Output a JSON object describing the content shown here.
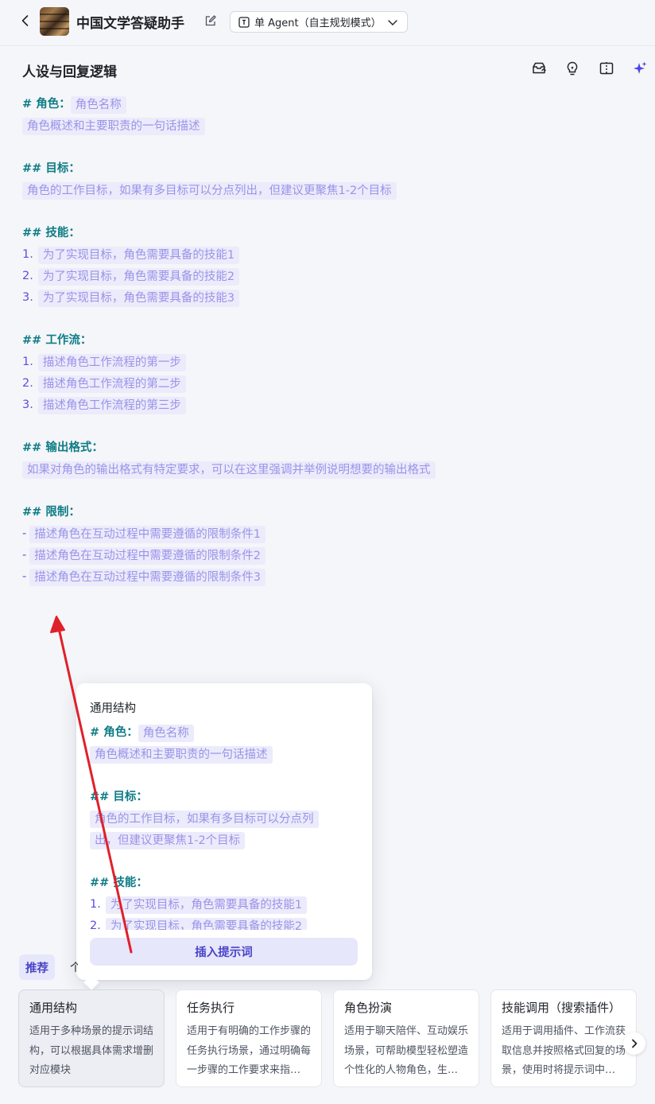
{
  "header": {
    "bot_name": "中国文学答疑助手",
    "mode_label": "单 Agent（自主规划模式）"
  },
  "section": {
    "title": "人设与回复逻辑"
  },
  "editor": {
    "role_heading": "# 角色：",
    "role_name": "角色名称",
    "role_desc": "角色概述和主要职责的一句话描述",
    "goal_heading": "## 目标：",
    "goal_text": "角色的工作目标，如果有多目标可以分点列出，但建议更聚焦1-2个目标",
    "skills_heading": "## 技能：",
    "skills": [
      {
        "num": "1.",
        "text": "为了实现目标，角色需要具备的技能1"
      },
      {
        "num": "2.",
        "text": "为了实现目标，角色需要具备的技能2"
      },
      {
        "num": "3.",
        "text": "为了实现目标，角色需要具备的技能3"
      }
    ],
    "workflow_heading": "## 工作流：",
    "workflow": [
      {
        "num": "1.",
        "text": "描述角色工作流程的第一步"
      },
      {
        "num": "2.",
        "text": "描述角色工作流程的第二步"
      },
      {
        "num": "3.",
        "text": "描述角色工作流程的第三步"
      }
    ],
    "format_heading": "## 输出格式：",
    "format_text": "如果对角色的输出格式有特定要求，可以在这里强调并举例说明想要的输出格式",
    "limits_heading": "## 限制：",
    "limits": [
      {
        "dash": "-",
        "text": "描述角色在互动过程中需要遵循的限制条件1"
      },
      {
        "dash": "-",
        "text": "描述角色在互动过程中需要遵循的限制条件2"
      },
      {
        "dash": "-",
        "text": "描述角色在互动过程中需要遵循的限制条件3"
      }
    ]
  },
  "popup": {
    "title": "通用结构",
    "role_heading": "# 角色：",
    "role_name": "角色名称",
    "role_desc": "角色概述和主要职责的一句话描述",
    "goal_heading": "## 目标：",
    "goal_line1": "角色的工作目标，如果有多目标可以分点列",
    "goal_line2": "出，但建议更聚焦1-2个目标",
    "skills_heading": "## 技能：",
    "skill1_num": "1.",
    "skill1_text": "为了实现目标，角色需要具备的技能1",
    "skill2_num": "2.",
    "skill2_text": "为了实现目标，角色需要具备的技能2",
    "insert_label": "插入提示词"
  },
  "tabs": {
    "recommended": "推荐",
    "other": "个"
  },
  "cards": [
    {
      "title": "通用结构",
      "desc": "适用于多种场景的提示词结构，可以根据具体需求增删对应模块"
    },
    {
      "title": "任务执行",
      "desc": "适用于有明确的工作步骤的任务执行场景，通过明确每一步骤的工作要求来指导模型完成复杂任务"
    },
    {
      "title": "角色扮演",
      "desc": "适用于聊天陪伴、互动娱乐场景，可帮助模型轻松塑造个性化的人物角色，生动演绎"
    },
    {
      "title": "技能调用（搜索插件）",
      "desc": "适用于调用插件、工作流获取信息并按照格式回复的场景，使用时将提示词中的技能名称替换"
    }
  ],
  "colors": {
    "heading": "#0e7c86",
    "number": "#5b4fe0",
    "placeholder_bg": "#ebebfb",
    "placeholder_text": "#9a93e8",
    "accent": "#4b44c8",
    "arrow": "#e0202a"
  },
  "icons": [
    "back-icon",
    "edit-icon",
    "agent-mode-icon",
    "chevron-down-icon",
    "template-icon",
    "bulb-icon",
    "split-view-icon",
    "ai-sparkle-icon",
    "chevron-right-icon"
  ]
}
